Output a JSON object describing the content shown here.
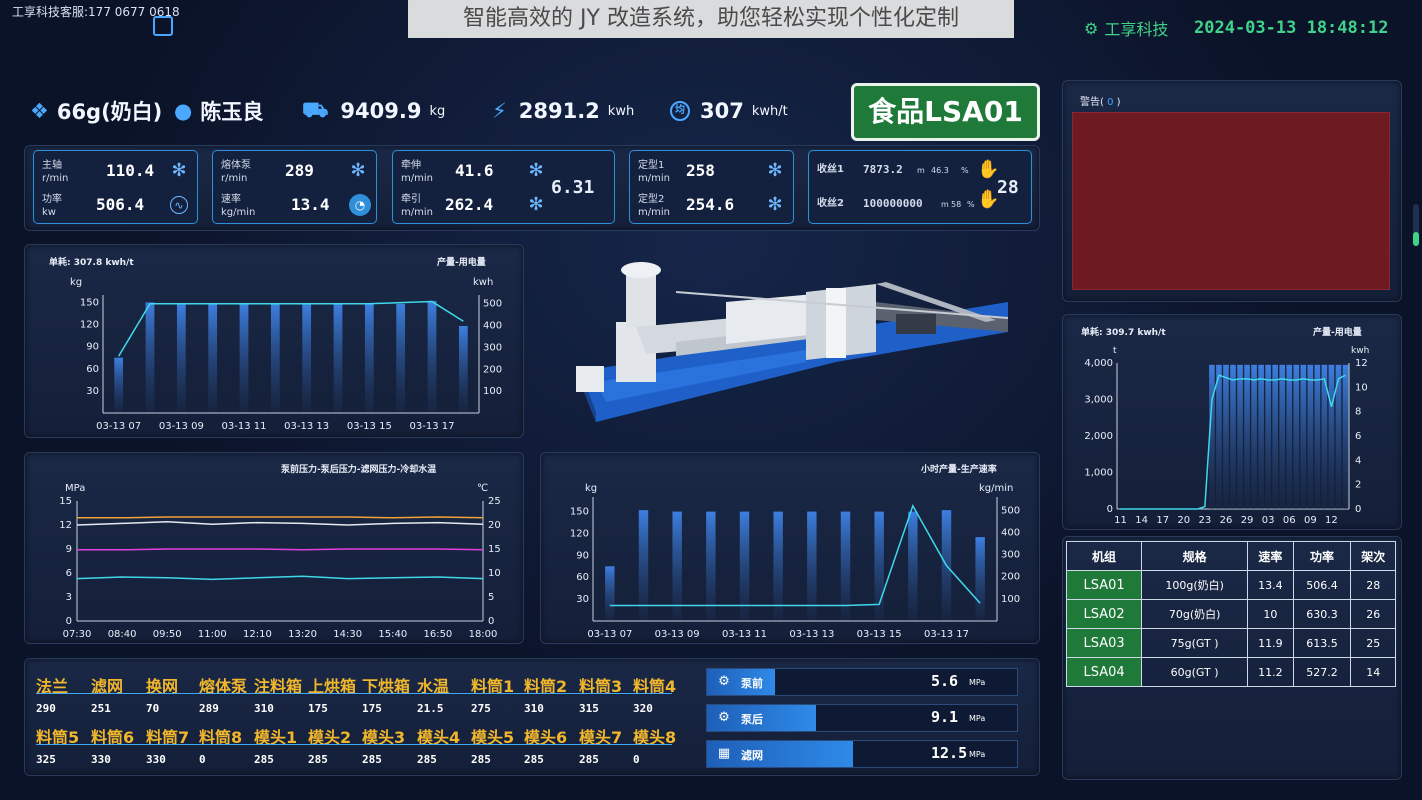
{
  "header": {
    "hotline": "工享科技客服:177 0677 0618",
    "title_overlay": "智能高效的 JY 改造系统，助您轻松实现个性化定制",
    "brand": "工享科技",
    "datetime": "2024-03-13 18:48:12"
  },
  "summary": {
    "product": "66g(奶白)",
    "operator": "陈玉良",
    "weight_value": "9409.9",
    "weight_unit": "kg",
    "energy_value": "2891.2",
    "energy_unit": "kwh",
    "avg_value": "307",
    "avg_unit": "kwh/t",
    "avg_icon_label": "均"
  },
  "product_badge": "食品LSA01",
  "metrics": {
    "box1": {
      "row1_label1": "主轴",
      "row1_label2": "r/min",
      "row1_value": "110.4",
      "row2_label1": "功率",
      "row2_label2": "kw",
      "row2_value": "506.4"
    },
    "box2": {
      "row1_label1": "熔体泵",
      "row1_label2": "r/min",
      "row1_value": "289",
      "row2_label1": "速率",
      "row2_label2": "kg/min",
      "row2_value": "13.4"
    },
    "box3": {
      "row1_label1": "牵伸",
      "row1_label2": "m/min",
      "row1_value": "41.6",
      "row2_label1": "牵引",
      "row2_label2": "m/min",
      "row2_value": "262.4",
      "ratio": "6.31"
    },
    "box4": {
      "row1_label1": "定型1",
      "row1_label2": "m/min",
      "row1_value": "258",
      "row2_label1": "定型2",
      "row2_label2": "m/min",
      "row2_value": "254.6"
    },
    "box5": {
      "row1_label": "收丝1",
      "row1_value": "7873.2",
      "row1_unit": "m",
      "row1_pct": "46.3",
      "row1_pct_unit": "%",
      "row2_label": "收丝2",
      "row2_value": "100000000",
      "row2_unit": "m",
      "row2_pct": "58",
      "count": "28"
    }
  },
  "chart1": {
    "title": "单耗: 307.8 kwh/t",
    "legend": "产量-用电量",
    "ylabel_left": "kg",
    "ylabel_right": "kwh"
  },
  "chart2": {
    "title": "泵前压力-泵后压力-滤网压力-冷却水温",
    "ylabel_left": "MPa",
    "ylabel_right": "℃"
  },
  "chart3": {
    "title": "小时产量-生产速率",
    "ylabel_left": "kg",
    "ylabel_right": "kg/min"
  },
  "chart4": {
    "title": "单耗: 309.7 kwh/t",
    "legend": "产量-用电量",
    "ylabel_left": "t",
    "ylabel_right": "kwh"
  },
  "chart_data": [
    {
      "type": "bar",
      "categories": [
        "03-13 07",
        "03-13 08",
        "03-13 09",
        "03-13 10",
        "03-13 11",
        "03-13 12",
        "03-13 13",
        "03-13 14",
        "03-13 15",
        "03-13 16",
        "03-13 17",
        "03-13 18"
      ],
      "tick_labels": [
        "03-13 07",
        "03-13 09",
        "03-13 11",
        "03-13 13",
        "03-13 15",
        "03-13 17"
      ],
      "series": [
        {
          "values": [
            75,
            150,
            148,
            148,
            148,
            148,
            148,
            148,
            148,
            148,
            152,
            118
          ]
        },
        {
          "values": [
            260,
            500,
            500,
            500,
            500,
            500,
            500,
            500,
            500,
            505,
            510,
            420
          ]
        }
      ],
      "ylim_left": [
        0,
        160
      ],
      "yticks_left": [
        30,
        60,
        90,
        120,
        150
      ],
      "ylim_right": [
        0,
        540
      ],
      "yticks_right": [
        100,
        200,
        300,
        400,
        500
      ]
    },
    {
      "type": "line",
      "x": [
        "07:30",
        "08:40",
        "09:50",
        "11:00",
        "12:10",
        "13:20",
        "14:30",
        "15:40",
        "16:50",
        "18:00"
      ],
      "series": [
        {
          "color": "#f0a23a",
          "values": [
            12.9,
            12.9,
            13.0,
            13.0,
            13.0,
            13.0,
            13.0,
            12.9,
            13.0,
            12.9
          ]
        },
        {
          "color": "#e8e8f0",
          "values": [
            12.0,
            12.2,
            12.4,
            12.1,
            12.3,
            12.2,
            12.0,
            12.2,
            12.3,
            12.1
          ]
        },
        {
          "color": "#e040e0",
          "values": [
            8.9,
            8.9,
            9.0,
            9.0,
            9.0,
            8.9,
            9.0,
            9.0,
            9.0,
            8.9
          ]
        },
        {
          "color": "#40d8e8",
          "values": [
            5.3,
            5.5,
            5.4,
            5.2,
            5.4,
            5.6,
            5.3,
            5.4,
            5.5,
            5.3
          ]
        }
      ],
      "ylim_left": [
        0,
        15
      ],
      "yticks_left": [
        0,
        3,
        6,
        9,
        12,
        15
      ],
      "ylim_right": [
        0,
        25
      ],
      "yticks_right": [
        0,
        5,
        10,
        15,
        20,
        25
      ]
    },
    {
      "type": "bar",
      "categories": [
        "03-13 07",
        "03-13 08",
        "03-13 09",
        "03-13 10",
        "03-13 11",
        "03-13 12",
        "03-13 13",
        "03-13 14",
        "03-13 15",
        "03-13 16",
        "03-13 17",
        "03-13 18"
      ],
      "tick_labels": [
        "03-13 07",
        "03-13 09",
        "03-13 11",
        "03-13 13",
        "03-13 15",
        "03-13 17"
      ],
      "series": [
        {
          "values": [
            75,
            152,
            150,
            150,
            150,
            150,
            150,
            150,
            150,
            150,
            152,
            115
          ]
        },
        {
          "values": [
            70,
            70,
            70,
            70,
            70,
            70,
            70,
            70,
            75,
            520,
            250,
            80
          ]
        }
      ],
      "ylim_left": [
        0,
        170
      ],
      "yticks_left": [
        30,
        60,
        90,
        120,
        150
      ],
      "ylim_right": [
        0,
        560
      ],
      "yticks_right": [
        100,
        200,
        300,
        400,
        500
      ]
    },
    {
      "type": "bar",
      "categories": [
        "11",
        "12",
        "13",
        "14",
        "15",
        "16",
        "17",
        "18",
        "19",
        "20",
        "21",
        "22",
        "23",
        "24",
        "25",
        "26",
        "27",
        "28",
        "29",
        "30",
        "31",
        "01",
        "02",
        "03",
        "04",
        "05",
        "06",
        "07",
        "08",
        "09",
        "10",
        "11",
        "12"
      ],
      "tick_labels": [
        "11",
        "14",
        "17",
        "20",
        "23",
        "26",
        "29",
        "03",
        "06",
        "09",
        "12"
      ],
      "series": [
        {
          "values": [
            0,
            0,
            0,
            0,
            0,
            0,
            0,
            0,
            0,
            0,
            0,
            0,
            0,
            3950,
            3950,
            3950,
            3950,
            3950,
            3950,
            3950,
            3950,
            3950,
            3950,
            3950,
            3950,
            3950,
            3950,
            3950,
            3950,
            3950,
            3950,
            3950,
            3950
          ]
        },
        {
          "values": [
            0,
            0,
            0,
            0,
            0,
            0,
            0,
            0,
            0,
            0,
            0,
            0,
            0.2,
            9,
            11,
            10.8,
            10.6,
            10.7,
            10.7,
            10.6,
            10.7,
            10.6,
            10.6,
            10.7,
            10.6,
            10.6,
            10.7,
            10.6,
            10.6,
            10.7,
            8.4,
            10.7,
            11
          ]
        }
      ],
      "ylim_left": [
        0,
        4000
      ],
      "yticks_left": [
        "0",
        "1,000",
        "2,000",
        "3,000",
        "4,000"
      ],
      "ylim_right": [
        0,
        12
      ],
      "yticks_right": [
        0,
        2,
        4,
        6,
        8,
        10,
        12
      ]
    }
  ],
  "alarm": {
    "label": "警告",
    "count": "0"
  },
  "params": {
    "row1_headers": [
      "法兰",
      "滤网",
      "换网",
      "熔体泵",
      "注料箱",
      "上烘箱",
      "下烘箱",
      "水温",
      "料筒1",
      "料筒2",
      "料筒3",
      "料筒4"
    ],
    "row1_values": [
      "290",
      "251",
      "70",
      "289",
      "310",
      "175",
      "175",
      "21.5",
      "275",
      "310",
      "315",
      "320"
    ],
    "row2_headers": [
      "料筒5",
      "料筒6",
      "料筒7",
      "料筒8",
      "模头1",
      "模头2",
      "模头3",
      "模头4",
      "模头5",
      "模头6",
      "模头7",
      "模头8"
    ],
    "row2_values": [
      "325",
      "330",
      "330",
      "0",
      "285",
      "285",
      "285",
      "285",
      "285",
      "285",
      "285",
      "0"
    ]
  },
  "pressures": [
    {
      "name": "泵前",
      "value": "5.6",
      "unit": "MPa",
      "fill_pct": 22
    },
    {
      "name": "泵后",
      "value": "9.1",
      "unit": "MPa",
      "fill_pct": 35
    },
    {
      "name": "滤网",
      "value": "12.5",
      "unit": "MPa",
      "fill_pct": 47
    }
  ],
  "unit_table": {
    "headers": [
      "机组",
      "规格",
      "速率",
      "功率",
      "架次"
    ],
    "rows": [
      [
        "LSA01",
        "100g(奶白)",
        "13.4",
        "506.4",
        "28"
      ],
      [
        "LSA02",
        "70g(奶白)",
        "10",
        "630.3",
        "26"
      ],
      [
        "LSA03",
        "75g(GT )",
        "11.9",
        "613.5",
        "25"
      ],
      [
        "LSA04",
        "60g(GT )",
        "11.2",
        "527.2",
        "14"
      ]
    ]
  }
}
